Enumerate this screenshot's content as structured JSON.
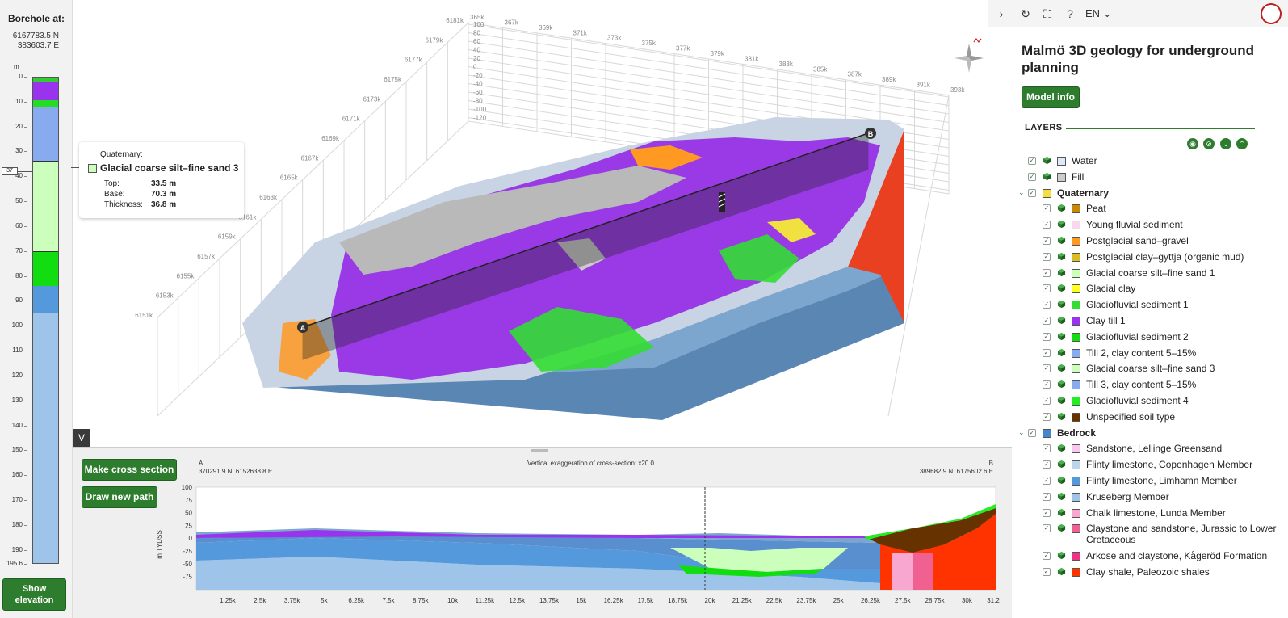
{
  "borehole": {
    "title": "Borehole at:",
    "north": "6167783.5 N",
    "east": "383603.7  E",
    "unit": "m",
    "marker": "37",
    "ticks": [
      "0",
      "10",
      "20",
      "30",
      "40",
      "50",
      "60",
      "70",
      "80",
      "90",
      "100",
      "110",
      "120",
      "130",
      "140",
      "150",
      "160",
      "170",
      "180",
      "190",
      "195.6"
    ],
    "show_elevation": "Show elevation",
    "column": [
      {
        "depth_top": 0,
        "depth_base": 2,
        "color": "#33cc33"
      },
      {
        "depth_top": 2,
        "depth_base": 9,
        "color": "#9933ee"
      },
      {
        "depth_top": 9,
        "depth_base": 12,
        "color": "#22dd22"
      },
      {
        "depth_top": 12,
        "depth_base": 33.5,
        "color": "#88aaee"
      },
      {
        "depth_top": 33.5,
        "depth_base": 70.3,
        "color": "#ccffbb"
      },
      {
        "depth_top": 70.3,
        "depth_base": 84,
        "color": "#11dd11"
      },
      {
        "depth_top": 84,
        "depth_base": 95,
        "color": "#5599dd"
      },
      {
        "depth_top": 95,
        "depth_base": 195.6,
        "color": "#9fc4ea"
      }
    ]
  },
  "tooltip": {
    "category": "Quaternary:",
    "name": "Glacial coarse silt–fine sand 3",
    "swatch": "#ccffbb",
    "top_label": "Top:",
    "top_value": "33.5 m",
    "base_label": "Base:",
    "base_value": "70.3 m",
    "thickness_label": "Thickness:",
    "thickness_value": "36.8 m"
  },
  "view3d": {
    "northing_labels": [
      "6151k",
      "6153k",
      "6155k",
      "6157k",
      "6159k",
      "6161k",
      "6163k",
      "6165k",
      "6167k",
      "6169k",
      "6171k",
      "6173k",
      "6175k",
      "6177k",
      "6179k",
      "6181k"
    ],
    "easting_labels": [
      "365k",
      "367k",
      "369k",
      "371k",
      "373k",
      "375k",
      "377k",
      "379k",
      "381k",
      "383k",
      "385k",
      "387k",
      "389k",
      "391k",
      "393k"
    ],
    "z_labels": [
      "100",
      "80",
      "60",
      "40",
      "20",
      "0",
      "-20",
      "-40",
      "-60",
      "-80",
      "-100",
      "-120"
    ],
    "point_a": "A",
    "point_b": "B",
    "collapse_label": "V"
  },
  "cross_section": {
    "make": "Make cross section",
    "draw": "Draw new path",
    "a_label": "A",
    "a_coords": "370291.9 N, 6152638.8 E",
    "b_label": "B",
    "b_coords": "389682.9 N, 6175602.6 E",
    "exaggeration": "Vertical exaggeration of cross-section: x20.0",
    "ylabel": "m TYDSS",
    "y_ticks": [
      "100",
      "75",
      "50",
      "25",
      "0",
      "-25",
      "-50",
      "-75"
    ],
    "x_ticks": [
      "1.25k",
      "2.5k",
      "3.75k",
      "5k",
      "6.25k",
      "7.5k",
      "8.75k",
      "10k",
      "11.25k",
      "12.5k",
      "13.75k",
      "15k",
      "16.25k",
      "17.5k",
      "18.75k",
      "20k",
      "21.25k",
      "22.5k",
      "23.75k",
      "25k",
      "26.25k",
      "27.5k",
      "28.75k",
      "30k",
      "31.2"
    ]
  },
  "toolbar": {
    "lang": "EN",
    "lang_caret": "⌄"
  },
  "panel": {
    "title": "Malmö 3D geology for underground planning",
    "model_info": "Model info",
    "layers_heading": "LAYERS"
  },
  "layers": [
    {
      "label": "Water",
      "color": "#dde8f8",
      "indent": 0,
      "group": false
    },
    {
      "label": "Fill",
      "color": "#cccccc",
      "indent": 0,
      "group": false
    },
    {
      "label": "Quaternary",
      "color": "#f0e040",
      "indent": 0,
      "group": true
    },
    {
      "label": "Peat",
      "color": "#cc8800",
      "indent": 1,
      "group": false
    },
    {
      "label": "Young fluvial sediment",
      "color": "#f8d8f0",
      "indent": 1,
      "group": false
    },
    {
      "label": "Postglacial sand–gravel",
      "color": "#ff9922",
      "indent": 1,
      "group": false
    },
    {
      "label": "Postglacial clay–gyttja (organic mud)",
      "color": "#ddbb22",
      "indent": 1,
      "group": false
    },
    {
      "label": "Glacial coarse silt–fine sand 1",
      "color": "#ccffbb",
      "indent": 1,
      "group": false
    },
    {
      "label": "Glacial clay",
      "color": "#ffff22",
      "indent": 1,
      "group": false
    },
    {
      "label": "Glaciofluvial sediment 1",
      "color": "#33dd33",
      "indent": 1,
      "group": false
    },
    {
      "label": "Clay till 1",
      "color": "#9933ee",
      "indent": 1,
      "group": false
    },
    {
      "label": "Glaciofluvial sediment 2",
      "color": "#11dd11",
      "indent": 1,
      "group": false
    },
    {
      "label": "Till 2, clay content 5–15%",
      "color": "#88aaee",
      "indent": 1,
      "group": false
    },
    {
      "label": "Glacial coarse silt–fine sand 3",
      "color": "#ccffbb",
      "indent": 1,
      "group": false
    },
    {
      "label": "Till 3, clay content 5–15%",
      "color": "#88aaee",
      "indent": 1,
      "group": false
    },
    {
      "label": "Glaciofluvial sediment 4",
      "color": "#22ee22",
      "indent": 1,
      "group": false
    },
    {
      "label": "Unspecified soil type",
      "color": "#663300",
      "indent": 1,
      "group": false
    },
    {
      "label": "Bedrock",
      "color": "#4488cc",
      "indent": 0,
      "group": true
    },
    {
      "label": "Sandstone, Lellinge Greensand",
      "color": "#f8c8f0",
      "indent": 1,
      "group": false
    },
    {
      "label": "Flinty limestone, Copenhagen Member",
      "color": "#bcd4ee",
      "indent": 1,
      "group": false
    },
    {
      "label": "Flinty limestone, Limhamn Member",
      "color": "#5599dd",
      "indent": 1,
      "group": false
    },
    {
      "label": "Kruseberg Member",
      "color": "#9fc4ea",
      "indent": 1,
      "group": false
    },
    {
      "label": "Chalk limestone, Lunda Member",
      "color": "#f8a8d0",
      "indent": 1,
      "group": false
    },
    {
      "label": "Claystone and sandstone, Jurassic to Lower Cretaceous",
      "color": "#f06090",
      "indent": 1,
      "group": false
    },
    {
      "label": "Arkose and claystone, Kågeröd Formation",
      "color": "#ee3388",
      "indent": 1,
      "group": false
    },
    {
      "label": "Clay shale, Paleozoic shales",
      "color": "#ff3300",
      "indent": 1,
      "group": false
    }
  ]
}
